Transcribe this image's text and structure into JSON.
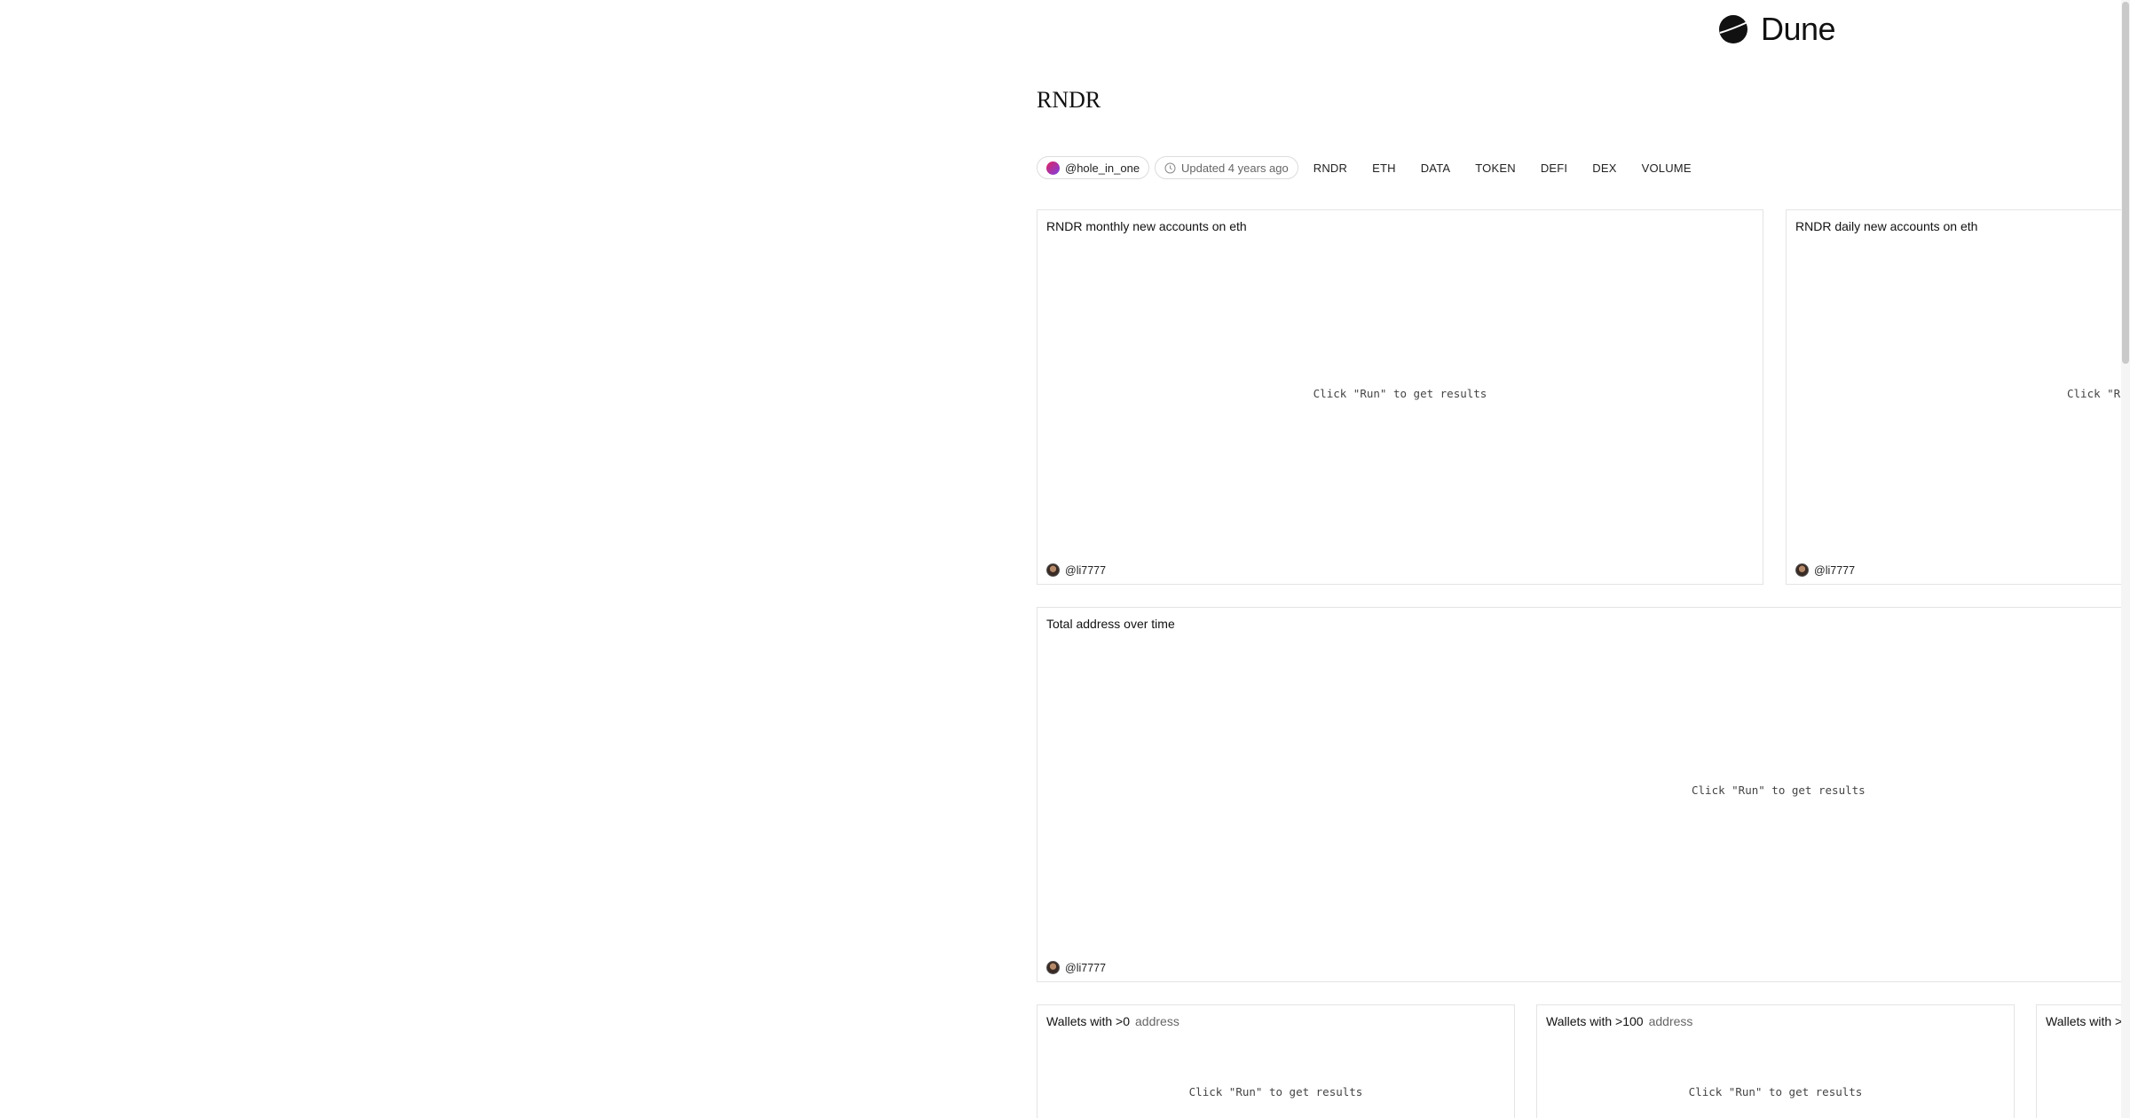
{
  "brand": {
    "name": "Dune"
  },
  "dashboard": {
    "title": "RNDR",
    "author": "@hole_in_one",
    "updated": "Updated 4 years ago",
    "tags": [
      "RNDR",
      "ETH",
      "DATA",
      "TOKEN",
      "DEFI",
      "DEX",
      "VOLUME"
    ]
  },
  "cards": [
    {
      "title": "RNDR monthly new accounts on eth",
      "message": "Click \"Run\" to get results",
      "author": "@li7777"
    },
    {
      "title": "RNDR daily new accounts on eth",
      "message": "Click \"Ru",
      "author": "@li7777"
    },
    {
      "title": "Total address over time",
      "message": "Click \"Run\" to get results",
      "author": "@li7777"
    },
    {
      "title": "Wallets with >0",
      "subtitle": "address",
      "message": "Click \"Run\" to get results"
    },
    {
      "title": "Wallets with >100",
      "subtitle": "address",
      "message": "Click \"Run\" to get results"
    },
    {
      "title": "Wallets with >"
    }
  ],
  "colors": {
    "card_border": "#e4e4e4",
    "muted_text": "#666666",
    "avatar_gradient_start": "#e0245e",
    "avatar_gradient_end": "#7b3fe4"
  },
  "icons": {
    "logo": "dune-logo-icon",
    "clock": "clock-icon",
    "author_avatar": "avatar-icon"
  }
}
